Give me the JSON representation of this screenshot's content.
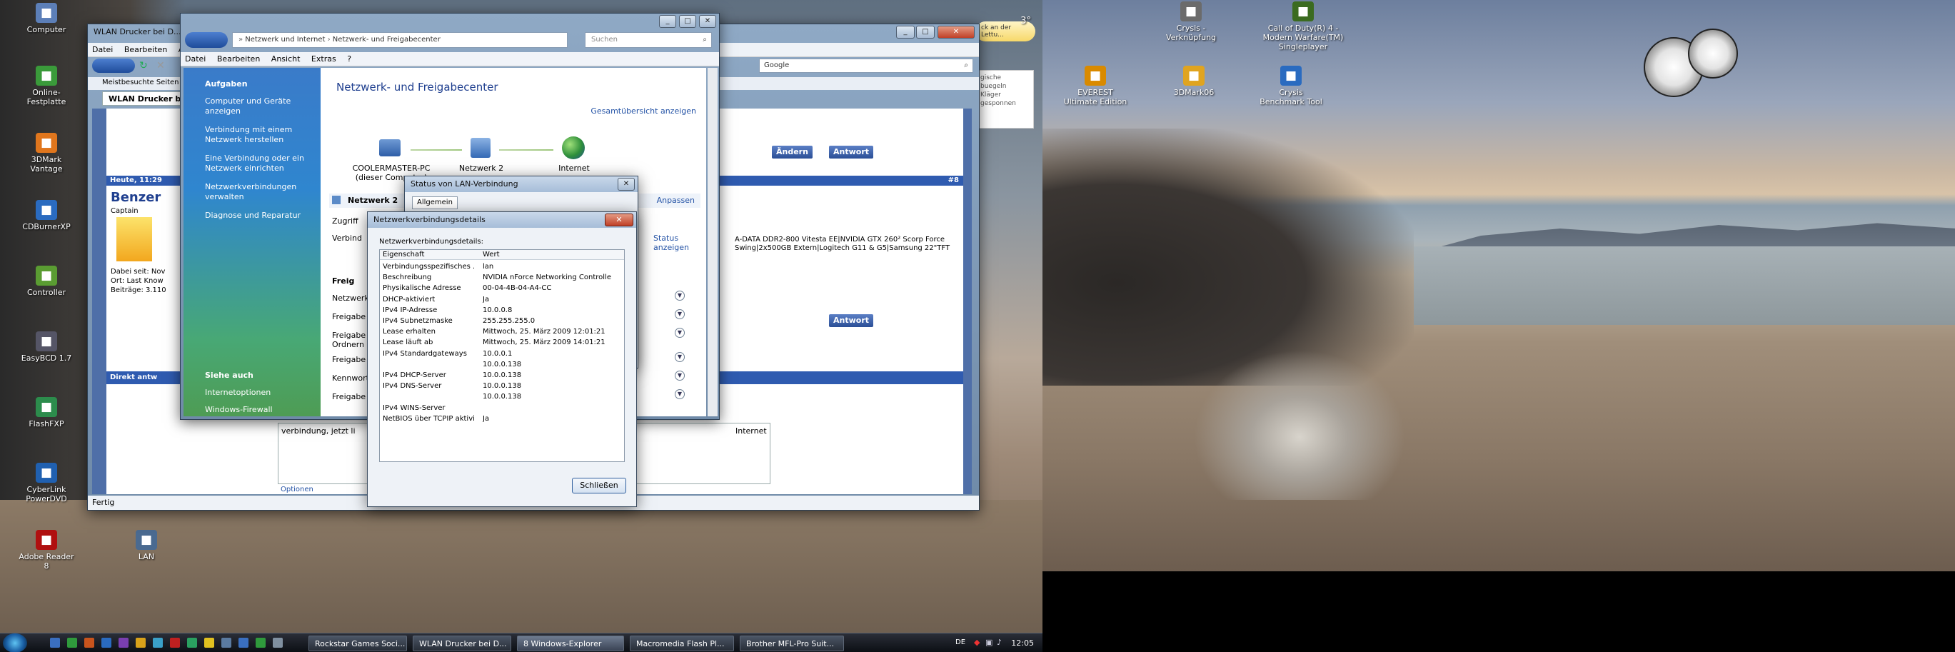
{
  "desktop_left": {
    "icons": [
      {
        "label": "Computer",
        "icon": "computer-icon",
        "color": "#5c7fb8"
      },
      {
        "label": "Online-Festplatte",
        "icon": "online-drive-icon",
        "color": "#3a9a3a"
      },
      {
        "label": "3DMark Vantage",
        "icon": "3dmark-icon",
        "color": "#e0761d"
      },
      {
        "label": "CDBurnerXP",
        "icon": "cd-icon",
        "color": "#2a6bc0"
      },
      {
        "label": "Controller",
        "icon": "controller-icon",
        "color": "#5a9c32"
      },
      {
        "label": "EasyBCD 1.7",
        "icon": "easybcd-icon",
        "color": "#556"
      },
      {
        "label": "FlashFXP",
        "icon": "flashfxp-icon",
        "color": "#2c8c4c"
      },
      {
        "label": "CyberLink PowerDVD",
        "icon": "powerdvd-icon",
        "color": "#2060b0"
      },
      {
        "label": "Adobe Reader 8",
        "icon": "adobe-icon",
        "color": "#b01010"
      },
      {
        "label": "LAN",
        "icon": "lan-icon",
        "color": "#4a6a90"
      }
    ]
  },
  "desktop_right": {
    "icons": [
      {
        "label": "Crysis - Verknüpfung",
        "icon": "crysis-icon",
        "color": "#6b6b6b"
      },
      {
        "label": "Call of Duty(R) 4 - Modern Warfare(TM) Singleplayer",
        "icon": "cod4-icon",
        "color": "#3b6b20"
      },
      {
        "label": "EVEREST Ultimate Edition",
        "icon": "everest-icon",
        "color": "#d98a00"
      },
      {
        "label": "3DMark06",
        "icon": "3dmark06-icon",
        "color": "#e0a420"
      },
      {
        "label": "Crysis Benchmark Tool",
        "icon": "benchmark-icon",
        "color": "#2a6bc0"
      }
    ]
  },
  "gadgets": {
    "weather_temp": "3°",
    "weather_text": "ck an der Lettu...",
    "note_text": "gische buegeln Kläger gesponnen"
  },
  "ie_window": {
    "title": "WLAN Drucker bei D...",
    "menu": [
      "Datei",
      "Bearbeiten",
      "Ans"
    ],
    "favorites": "Meistbesuchte Seiten",
    "tab": "WLAN Drucker bei D...",
    "search_placeholder": "Google",
    "status": "Fertig",
    "post": {
      "date": "Heute, 11:29",
      "user": "Benzer",
      "rank": "Captain",
      "since": "Dabei seit: Nov",
      "place": "Ort: Last Know",
      "posts": "Beiträge: 3.110",
      "sig": "A-DATA DDR2-800 Vitesta EE|NVIDIA GTX 260² Scorp Force Swing|2x500GB Extern|Logitech G11 & G5|Samsung 22\"TFT",
      "number": "#8"
    },
    "buttons": {
      "answer": "Antwort",
      "change": "Ändern",
      "answer2": "Antwort"
    },
    "quick_reply": "Direkt antw",
    "reply_text": "verbindung, jetzt li",
    "reply_text2": "Internet",
    "options": "Optionen"
  },
  "explorer": {
    "breadcrumb": [
      "Netzwerk und Internet",
      "Netzwerk- und Freigabecenter"
    ],
    "search_placeholder": "Suchen",
    "menu": [
      "Datei",
      "Bearbeiten",
      "Ansicht",
      "Extras",
      "?"
    ],
    "tasks_title": "Aufgaben",
    "tasks": [
      "Computer und Geräte anzeigen",
      "Verbindung mit einem Netzwerk herstellen",
      "Eine Verbindung oder ein Netzwerk einrichten",
      "Netzwerkverbindungen verwalten",
      "Diagnose und Reparatur"
    ],
    "see_also_title": "Siehe auch",
    "see_also": [
      "Internetoptionen",
      "Windows-Firewall"
    ],
    "heading": "Netzwerk- und Freigabecenter",
    "full_map": "Gesamtübersicht anzeigen",
    "map": {
      "pc": "COOLERMASTER-PC",
      "pc_sub": "(dieser Computer)",
      "network": "Netzwerk  2",
      "internet": "Internet"
    },
    "network_label": "Netzwerk  2",
    "access_label": "Zugriff",
    "connection_label": "Verbind",
    "customize": "Anpassen",
    "status_link": "Status anzeigen",
    "sharing_label": "Freig",
    "rows": [
      "Netzwerk",
      "Freigabe",
      "Freigabe Ordnern",
      "Freigabe",
      "Kennwort",
      "Freigabe"
    ]
  },
  "status_dialog": {
    "title": "Status von LAN-Verbindung",
    "tab": "Allgemein"
  },
  "details_dialog": {
    "title": "Netzwerkverbindungsdetails",
    "section": "Netzwerkverbindungsdetails:",
    "col_property": "Eigenschaft",
    "col_value": "Wert",
    "rows": [
      {
        "k": "Verbindungsspezifisches ...",
        "v": "lan"
      },
      {
        "k": "Beschreibung",
        "v": "NVIDIA nForce Networking Controller"
      },
      {
        "k": "Physikalische Adresse",
        "v": "00-04-4B-04-A4-CC"
      },
      {
        "k": "DHCP-aktiviert",
        "v": "Ja"
      },
      {
        "k": "IPv4 IP-Adresse",
        "v": "10.0.0.8"
      },
      {
        "k": "IPv4 Subnetzmaske",
        "v": "255.255.255.0"
      },
      {
        "k": "Lease erhalten",
        "v": "Mittwoch, 25. März 2009 12:01:21"
      },
      {
        "k": "Lease läuft ab",
        "v": "Mittwoch, 25. März 2009 14:01:21"
      },
      {
        "k": "IPv4 Standardgateways",
        "v": "10.0.0.1"
      },
      {
        "k": "",
        "v": "10.0.0.138"
      },
      {
        "k": "IPv4 DHCP-Server",
        "v": "10.0.0.138"
      },
      {
        "k": "IPv4 DNS-Server",
        "v": "10.0.0.138"
      },
      {
        "k": "",
        "v": "10.0.0.138"
      },
      {
        "k": "IPv4 WINS-Server",
        "v": ""
      },
      {
        "k": "NetBIOS über TCPIP aktivi...",
        "v": "Ja"
      }
    ],
    "close_button": "Schließen"
  },
  "taskbar": {
    "tasks": [
      "Rockstar Games Soci...",
      "WLAN Drucker bei D...",
      "8 Windows-Explorer",
      "Macromedia Flash Pl...",
      "Brother MFL-Pro Suit..."
    ],
    "clock": "12:05",
    "lang": "DE"
  }
}
